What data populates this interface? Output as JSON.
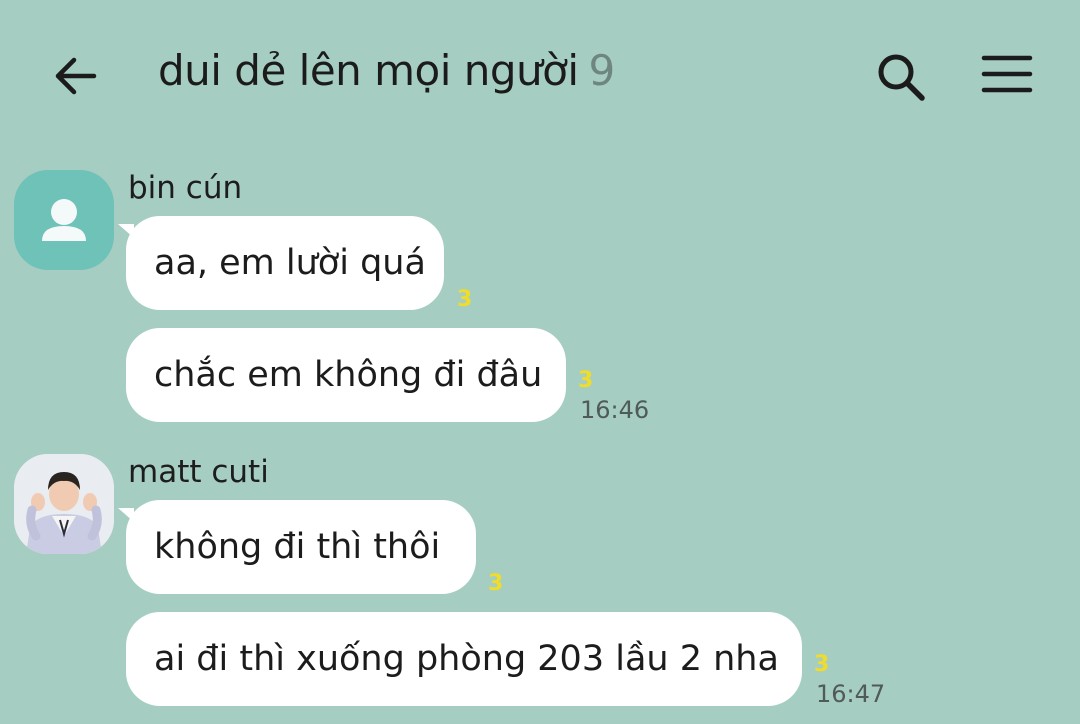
{
  "header": {
    "title": "dui dẻ lên mọi người",
    "member_count": "9",
    "back_icon": "arrow-left-icon",
    "search_icon": "search-icon",
    "menu_icon": "hamburger-menu-icon"
  },
  "colors": {
    "background": "#a5cdc1",
    "bubble": "#ffffff",
    "unread": "#f0dc2a",
    "default_avatar": "#6fc2b8"
  },
  "messages": [
    {
      "sender": "bin cún",
      "avatar": "default-person-icon",
      "bubbles": [
        {
          "text": "aa, em lười quá",
          "unread": "3",
          "time": ""
        },
        {
          "text": "chắc em không đi đâu",
          "unread": "3",
          "time": "16:46"
        }
      ]
    },
    {
      "sender": "matt cuti",
      "avatar": "profile-photo",
      "bubbles": [
        {
          "text": "không đi thì thôi",
          "unread": "3",
          "time": ""
        },
        {
          "text": "ai đi thì xuống phòng 203 lầu 2 nha",
          "unread": "3",
          "time": "16:47"
        }
      ]
    }
  ]
}
